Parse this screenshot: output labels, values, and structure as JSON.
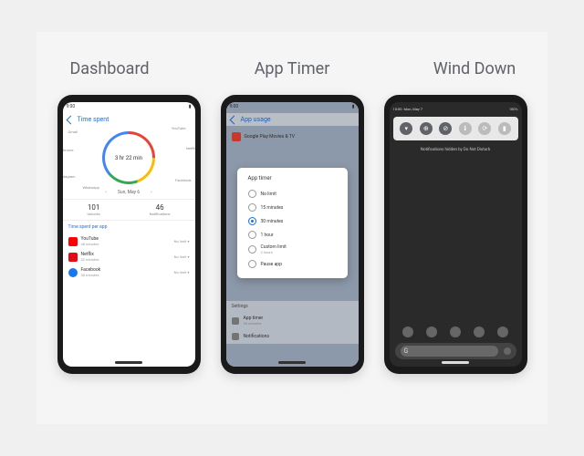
{
  "titles": [
    "Dashboard",
    "App Timer",
    "Wind Down"
  ],
  "dashboard": {
    "back": "Time spent",
    "total": "3 hr 22 min",
    "segments": [
      "YouTube",
      "Netflix",
      "Facebook",
      "WhatsApp",
      "Instagram",
      "Chrome",
      "Gmail"
    ],
    "date": "Sun, May 6",
    "unlocks": {
      "n": "101",
      "l": "Unlocks"
    },
    "notifs": {
      "n": "46",
      "l": "Notifications"
    },
    "section": "Time spent per app",
    "apps": [
      {
        "name": "YouTube",
        "sub": "48 minutes",
        "color": "#ff0000",
        "dd": "No limit ▾"
      },
      {
        "name": "Netflix",
        "sub": "32 minutes",
        "color": "#e50914",
        "dd": "No limit ▾"
      },
      {
        "name": "Facebook",
        "sub": "30 minutes",
        "color": "#1877f2",
        "dd": "No limit ▾"
      }
    ]
  },
  "timer": {
    "header": "App usage",
    "bgapp": "Google Play Movies & TV",
    "cardTitle": "App timer",
    "options": [
      {
        "t": "No limit",
        "sel": false
      },
      {
        "t": "15 minutes",
        "sel": false
      },
      {
        "t": "30 minutes",
        "sel": true
      },
      {
        "t": "1 hour",
        "sel": false
      },
      {
        "t": "Custom limit",
        "s": "2 hours",
        "sel": false
      },
      {
        "t": "Pause app",
        "sel": false
      }
    ],
    "settings": [
      {
        "t": "App timer",
        "s": "30 minutes"
      },
      {
        "t": "Notifications"
      }
    ]
  },
  "winddown": {
    "time": "10:00",
    "date": "Mon, May 7",
    "battery": "100%",
    "dnd": "Notifications hidden by Do Not Disturb",
    "toggles": [
      "▾",
      "⊕",
      "⊘",
      "ℹ",
      "⟳",
      "▮"
    ]
  }
}
